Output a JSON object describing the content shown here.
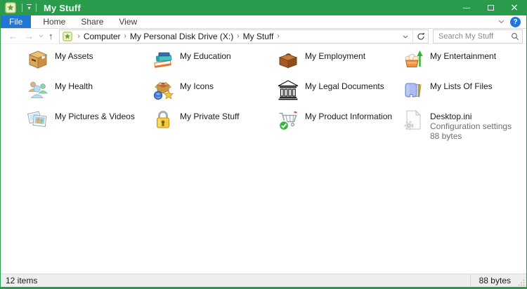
{
  "window": {
    "title": "My Stuff",
    "controls": {
      "minimize_icon": "minimize-icon",
      "maximize_icon": "maximize-icon",
      "close_icon": "close-icon"
    }
  },
  "ribbon": {
    "tabs": [
      "File",
      "Home",
      "Share",
      "View"
    ],
    "active_tab": "File",
    "help_icon_label": "?",
    "expand_ribbon_icon": "chevron-down-icon"
  },
  "address_bar": {
    "back_icon": "←",
    "forward_icon": "→",
    "up_icon": "↑",
    "recent_locations_icon": "⌄",
    "crumbs": [
      "Computer",
      "My Personal Disk Drive (X:)",
      "My Stuff"
    ],
    "crumb_separator": "›",
    "dropdown_icon": "⌄",
    "refresh_icon": "refresh-icon"
  },
  "search": {
    "placeholder": "Search My Stuff"
  },
  "main": {
    "items": [
      {
        "label": "My Assets",
        "icon": "box-icon"
      },
      {
        "label": "My Education",
        "icon": "books-icon"
      },
      {
        "label": "My Employment",
        "icon": "briefcase-icon"
      },
      {
        "label": "My Entertainment",
        "icon": "popcorn-icon"
      },
      {
        "label": "My Health",
        "icon": "people-icon"
      },
      {
        "label": "My Icons",
        "icon": "open-box-icon"
      },
      {
        "label": "My Legal Documents",
        "icon": "bank-icon"
      },
      {
        "label": "My Lists Of Files",
        "icon": "folder-files-icon"
      },
      {
        "label": "My Pictures & Videos",
        "icon": "photos-icon"
      },
      {
        "label": "My Private Stuff",
        "icon": "padlock-icon"
      },
      {
        "label": "My Product Information",
        "icon": "cart-check-icon"
      },
      {
        "label": "Desktop.ini",
        "description": "Configuration settings",
        "size": "88 bytes",
        "icon": "settings-file-icon"
      }
    ]
  },
  "status_bar": {
    "items_count": "12 items",
    "size": "88 bytes"
  },
  "colors": {
    "titlebar_green": "#2a9a4d",
    "file_tab_blue": "#2277d4",
    "help_blue": "#2277d4",
    "status_bg": "#eeeeee",
    "muted_text": "#6f6f6f"
  }
}
